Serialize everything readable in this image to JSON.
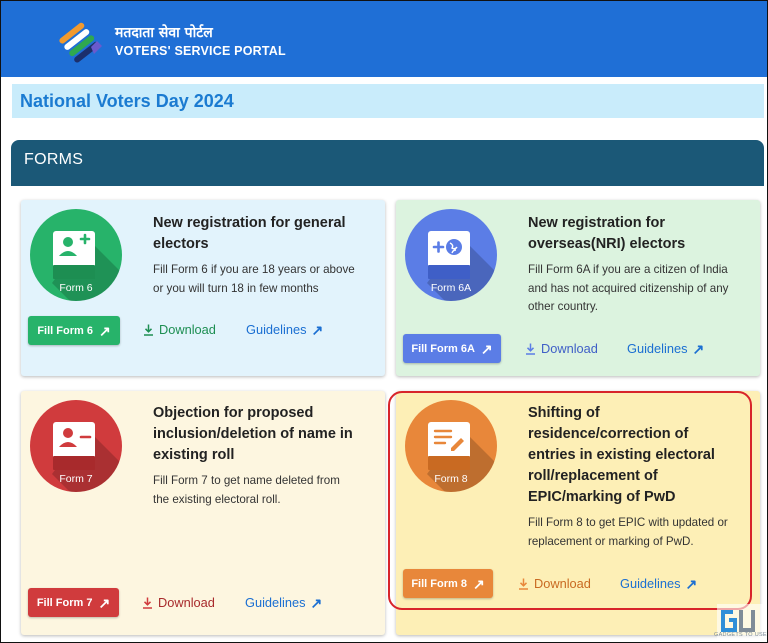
{
  "header": {
    "brand_hindi": "मतदाता सेवा पोर्टल",
    "brand_english": "VOTERS' SERVICE PORTAL",
    "bg_color": "#1f6fd6"
  },
  "banner": {
    "title": "National Voters Day 2024"
  },
  "section": {
    "title": "FORMS"
  },
  "cards": [
    {
      "title_lines": [
        "New registration for general",
        "electors"
      ],
      "desc_lines": [
        "Fill Form 6 if you are 18 years or above",
        "or you will turn 18 in few months"
      ],
      "badge": "Form 6",
      "fill_label": "Fill Form 6",
      "download_label": "Download",
      "guidelines_label": "Guidelines",
      "accent": "#27b36a",
      "bg": "#e2f3fc",
      "icon": "add-user-icon"
    },
    {
      "title_lines": [
        "New registration for",
        "overseas(NRI) electors"
      ],
      "desc_lines": [
        "Fill Form 6A if you are a citizen of India",
        "and has not acquired citizenship of any",
        "other country."
      ],
      "badge": "Form 6A",
      "fill_label": "Fill Form 6A",
      "download_label": "Download",
      "guidelines_label": "Guidelines",
      "accent": "#5b7de6",
      "bg": "#dcf3df",
      "icon": "globe-plus-icon"
    },
    {
      "title_lines": [
        "Objection for proposed",
        "inclusion/deletion of name in",
        "existing roll"
      ],
      "desc_lines": [
        "Fill Form 7 to get name deleted from",
        "the existing electoral roll."
      ],
      "badge": "Form 7",
      "fill_label": "Fill Form 7",
      "download_label": "Download",
      "guidelines_label": "Guidelines",
      "accent": "#d03b3d",
      "bg": "#fdf6e0",
      "icon": "remove-user-icon"
    },
    {
      "title_lines": [
        "Shifting of",
        "residence/correction of",
        "entries in existing electoral",
        "roll/replacement of",
        "EPIC/marking of PwD"
      ],
      "desc_lines": [
        "Fill Form 8 to get EPIC with updated or",
        "replacement or marking of PwD."
      ],
      "badge": "Form 8",
      "fill_label": "Fill Form 8",
      "download_label": "Download",
      "guidelines_label": "Guidelines",
      "accent": "#e8873a",
      "bg": "#fdefb6",
      "icon": "edit-document-icon"
    }
  ],
  "watermark": {
    "text": "GADGETS TO USE"
  }
}
